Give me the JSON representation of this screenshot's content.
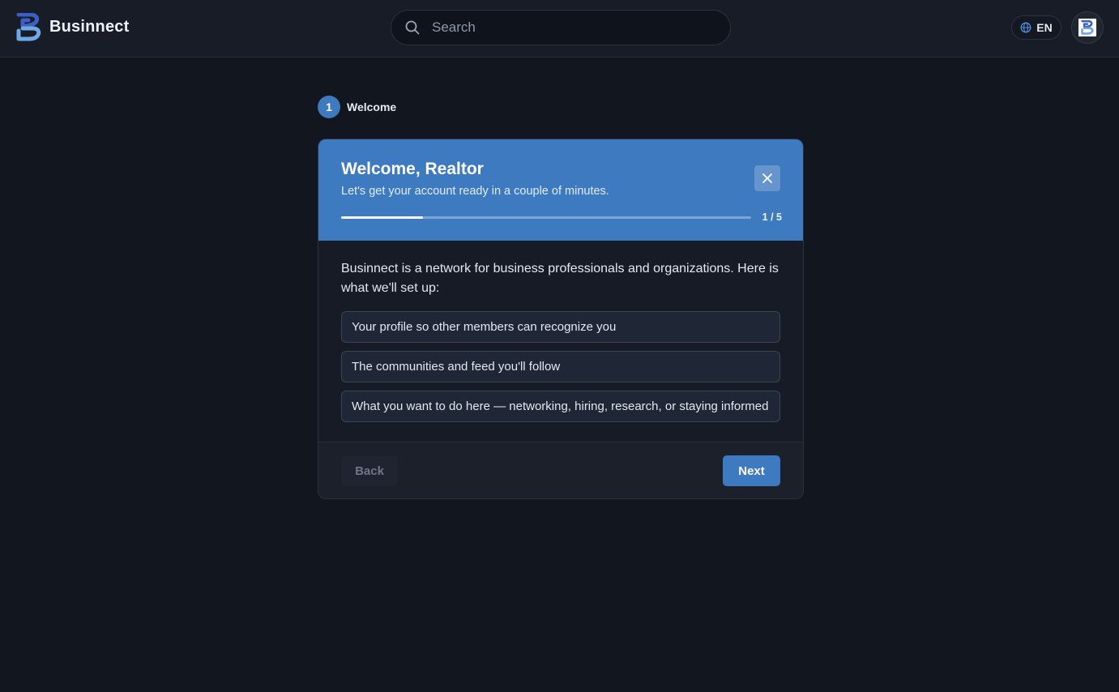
{
  "header": {
    "brand_name": "Businnect",
    "search": {
      "placeholder": "Search"
    },
    "language": "EN"
  },
  "stepper": {
    "current_step": "1",
    "current_label": "Welcome"
  },
  "card": {
    "title": "Welcome, Realtor",
    "subtitle": "Let's get your account ready in a couple of minutes.",
    "progress": {
      "text": "1 / 5",
      "current": 1,
      "total": 5
    },
    "intro": "Businnect is a network for business professionals and organizations. Here is what we'll set up:",
    "items": [
      "Your profile so other members can recognize you",
      "The communities and feed you'll follow",
      "What you want to do here — networking, hiring, research, or staying informed"
    ],
    "back_label": "Back",
    "next_label": "Next"
  },
  "colors": {
    "accent": "#3d7abf",
    "background": "#12161f",
    "header_bg": "#171c26"
  },
  "icons": {
    "logo": "businnect-logo",
    "search": "search-icon",
    "language": "globe-icon",
    "close": "close-icon"
  }
}
